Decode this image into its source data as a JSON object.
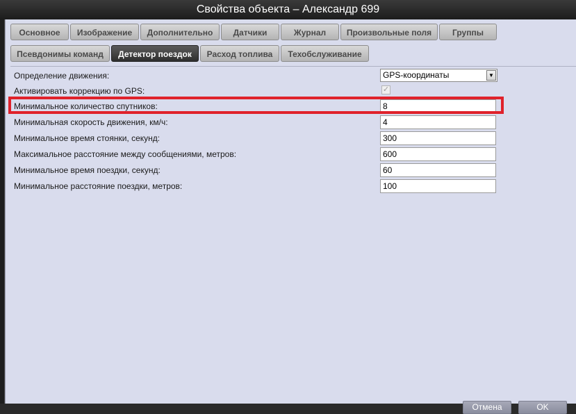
{
  "window": {
    "title": "Свойства объекта – Александр 699"
  },
  "tabs_row1": [
    {
      "label": "Основное"
    },
    {
      "label": "Изображение"
    },
    {
      "label": "Дополнительно"
    },
    {
      "label": "Датчики"
    },
    {
      "label": "Журнал"
    },
    {
      "label": "Произвольные поля"
    },
    {
      "label": "Группы"
    }
  ],
  "tabs_row2": [
    {
      "label": "Псевдонимы команд"
    },
    {
      "label": "Детектор поездок",
      "active": true
    },
    {
      "label": "Расход топлива"
    },
    {
      "label": "Техобслуживание"
    }
  ],
  "form": {
    "movement_detection": {
      "label": "Определение движения:",
      "value": "GPS-координаты"
    },
    "gps_correction": {
      "label": "Активировать коррекцию по GPS:",
      "checked": true
    },
    "min_satellites": {
      "label": "Минимальное количество спутников:",
      "value": "8"
    },
    "min_speed": {
      "label": "Минимальная скорость движения, км/ч:",
      "value": "4"
    },
    "min_stop_time": {
      "label": "Минимальное время стоянки, секунд:",
      "value": "300"
    },
    "max_distance": {
      "label": "Максимальное расстояние между сообщениями, метров:",
      "value": "600"
    },
    "min_trip_time": {
      "label": "Минимальное время поездки, секунд:",
      "value": "60"
    },
    "min_trip_distance": {
      "label": "Минимальное расстояние поездки, метров:",
      "value": "100"
    }
  },
  "buttons": {
    "cancel": "Отмена",
    "ok": "OK"
  },
  "icons": {
    "dropdown": "chevron-down-icon",
    "checkbox": "check-icon"
  },
  "colors": {
    "highlight": "#e0222b",
    "panel": "#d9dced",
    "active_tab": "#3a3a3a"
  }
}
